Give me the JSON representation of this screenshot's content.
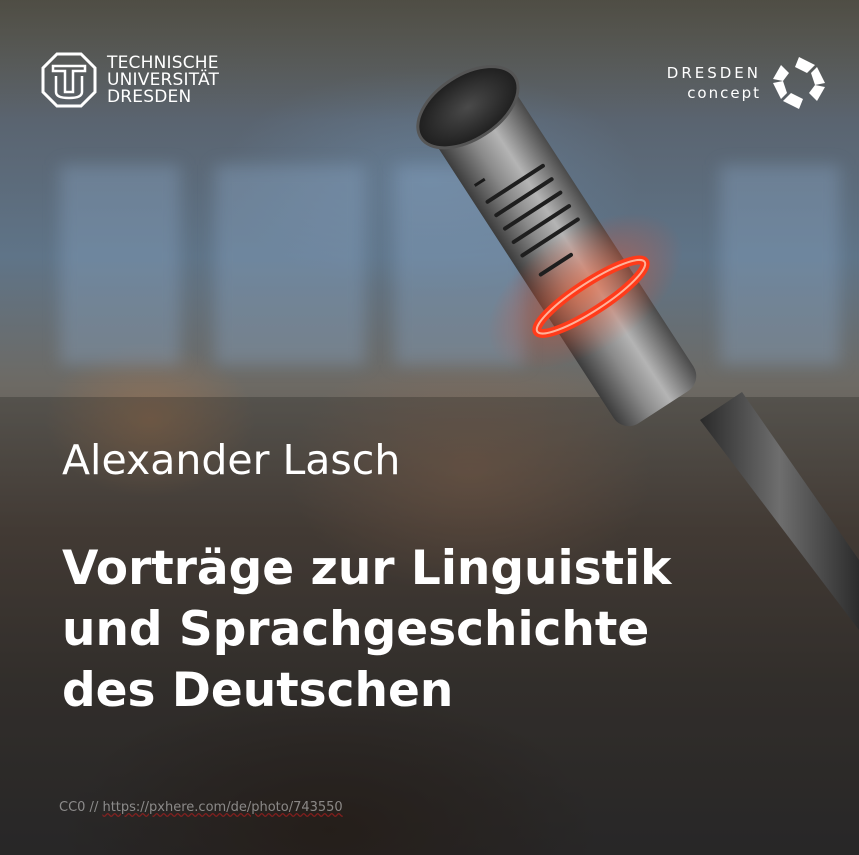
{
  "background": {
    "description_icon": "conference-microphone-photo",
    "accent_ring_color": "#ff3b1a"
  },
  "logo_tud": {
    "icon": "tu-dresden-emblem-icon",
    "lines": [
      "TECHNISCHE",
      "UNIVERSITÄT",
      "DRESDEN"
    ]
  },
  "logo_dresden_concept": {
    "icon": "dresden-concept-emblem-icon",
    "line1": "DRESDEN",
    "line2": "concept"
  },
  "author": "Alexander Lasch",
  "title_lines": [
    "Vorträge zur Linguistik",
    "und Sprachgeschichte",
    "des Deutschen"
  ],
  "credit": {
    "license": "CC0 // ",
    "url": "https://pxhere.com/de/photo/743550"
  }
}
